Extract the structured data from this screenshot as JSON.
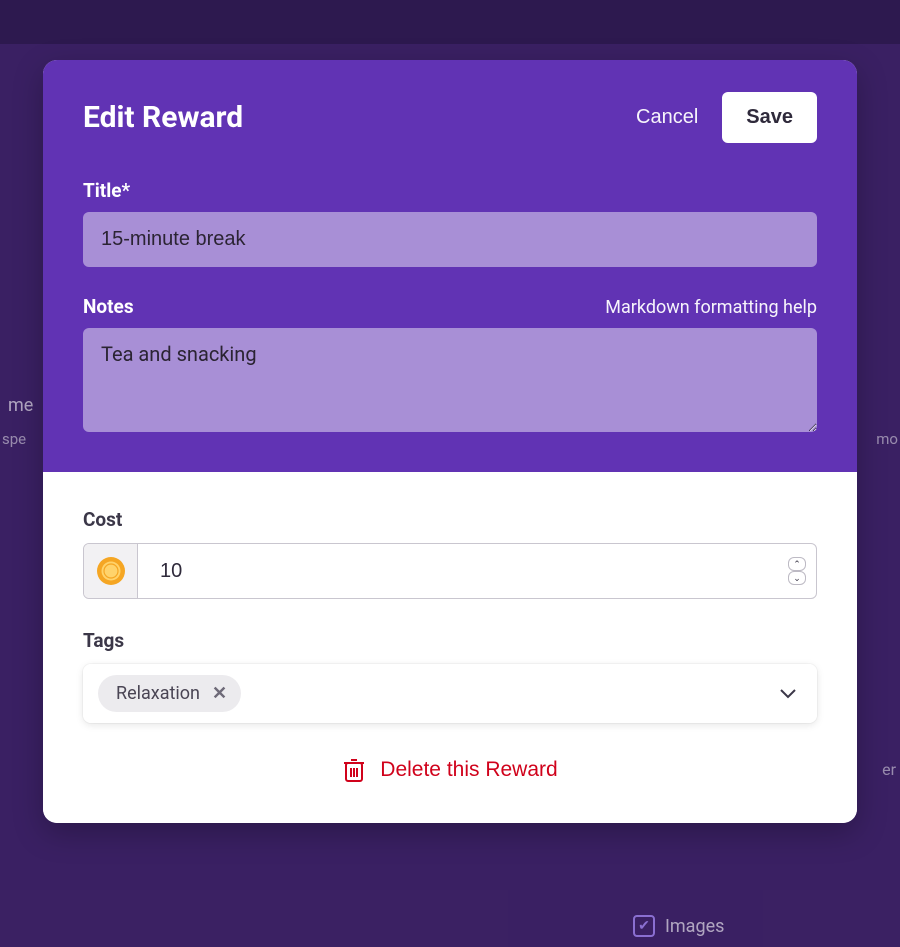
{
  "modal": {
    "title": "Edit Reward",
    "cancel_label": "Cancel",
    "save_label": "Save",
    "title_field": {
      "label": "Title*",
      "value": "15-minute break"
    },
    "notes_field": {
      "label": "Notes",
      "help_text": "Markdown formatting help",
      "value": "Tea and snacking"
    },
    "cost_field": {
      "label": "Cost",
      "value": "10"
    },
    "tags_field": {
      "label": "Tags",
      "tags": [
        {
          "name": "Relaxation"
        }
      ]
    },
    "delete_label": "Delete this Reward"
  },
  "colors": {
    "accent": "#6133b4",
    "danger": "#d0021b",
    "coin_outer": "#f5a623",
    "coin_inner": "#ffd36b"
  }
}
